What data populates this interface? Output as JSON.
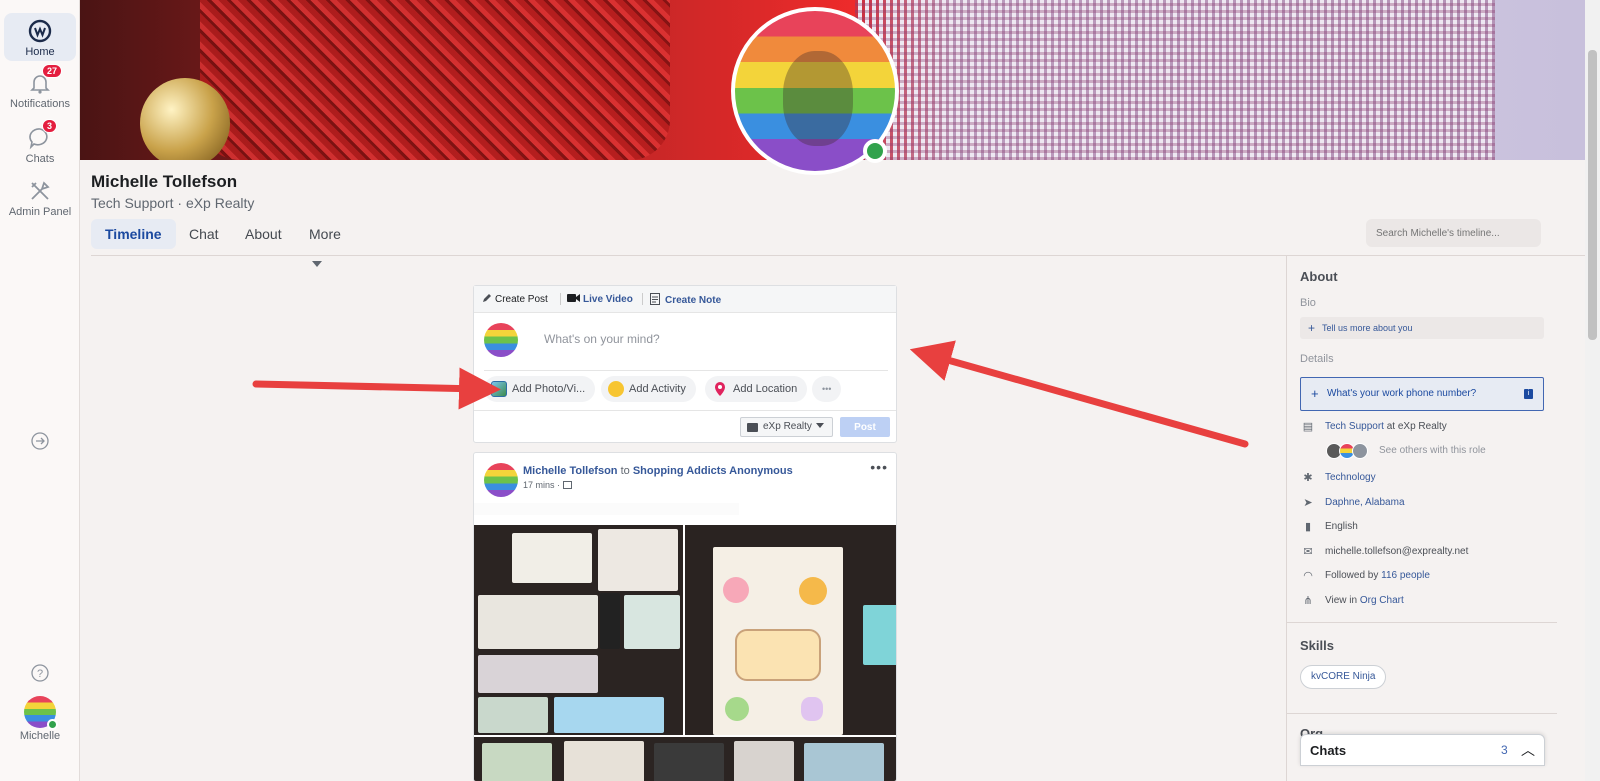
{
  "rail": {
    "home_label": "Home",
    "notifications_label": "Notifications",
    "notifications_count": "27",
    "chats_label": "Chats",
    "chats_count": "3",
    "admin_label": "Admin Panel",
    "user_label": "Michelle"
  },
  "profile": {
    "name": "Michelle Tollefson",
    "subtitle": "Tech Support · eXp Realty"
  },
  "tabs": [
    "Timeline",
    "Chat",
    "About",
    "More"
  ],
  "search": {
    "placeholder": "Search Michelle's timeline..."
  },
  "composer": {
    "create_post": "Create Post",
    "live_video": "Live Video",
    "create_note": "Create Note",
    "placeholder": "What's on your mind?",
    "add_photo": "Add Photo/Vi...",
    "add_activity": "Add Activity",
    "add_location": "Add Location",
    "more": "•••",
    "audience": "eXp Realty",
    "post_label": "Post"
  },
  "post": {
    "author": "Michelle Tollefson",
    "to": "to",
    "group": "Shopping Addicts Anonymous",
    "time": "17 mins",
    "more": "•••"
  },
  "about": {
    "title": "About",
    "bio_label": "Bio",
    "tell_us": "Tell us more about you",
    "details_label": "Details",
    "work_phone": "What's your work phone number?",
    "role": "Tech Support",
    "role_at": " at eXp Realty",
    "see_others": "See others with this role",
    "industry": "Technology",
    "location": "Daphne, Alabama",
    "language": "English",
    "email": "michelle.tollefson@exprealty.net",
    "followed_prefix": "Followed by ",
    "followed_count": "116 people",
    "view_in": "View in ",
    "org_chart": "Org Chart"
  },
  "skills": {
    "title": "Skills",
    "items": [
      "kvCORE Ninja"
    ]
  },
  "org": {
    "title": "Org"
  },
  "chatdock": {
    "title": "Chats",
    "count": "3",
    "chevron": "︿"
  },
  "colors": {
    "accent": "#4267b2",
    "link": "#365899",
    "badge": "#e41e3f",
    "online": "#31a24c",
    "arrow": "#e8403f"
  }
}
